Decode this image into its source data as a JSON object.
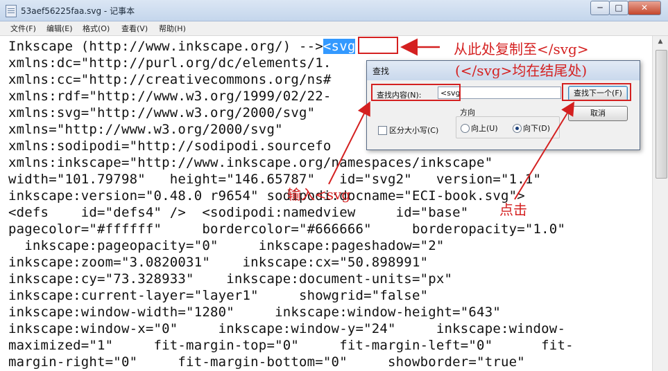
{
  "window": {
    "title": "53aef56225faa.svg - 记事本",
    "minimize": "─",
    "maximize": "□",
    "close": "✕"
  },
  "menu": [
    "文件(F)",
    "编辑(E)",
    "格式(O)",
    "查看(V)",
    "帮助(H)"
  ],
  "editor": {
    "line0_prefix": "Inkscape (http://www.inkscape.org/) -->",
    "line0_selected": "<svg",
    "lines": [
      "xmlns:dc=\"http://purl.org/dc/elements/1.",
      "xmlns:cc=\"http://creativecommons.org/ns#",
      "xmlns:rdf=\"http://www.w3.org/1999/02/22-",
      "xmlns:svg=\"http://www.w3.org/2000/svg\"",
      "xmlns=\"http://www.w3.org/2000/svg\"",
      "xmlns:sodipodi=\"http://sodipodi.sourcefo",
      "xmlns:inkscape=\"http://www.inkscape.org/namespaces/inkscape\"",
      "width=\"101.79798\"   height=\"146.65787\"   id=\"svg2\"   version=\"1.1\"",
      "inkscape:version=\"0.48.0 r9654\" sodipodi:docname=\"ECI-book.svg\">",
      "<defs    id=\"defs4\" />  <sodipodi:namedview     id=\"base\"",
      "pagecolor=\"#ffffff\"     bordercolor=\"#666666\"     borderopacity=\"1.0\"",
      "  inkscape:pageopacity=\"0\"     inkscape:pageshadow=\"2\"",
      "inkscape:zoom=\"3.0820031\"    inkscape:cx=\"50.898991\"",
      "inkscape:cy=\"73.328933\"    inkscape:document-units=\"px\"",
      "inkscape:current-layer=\"layer1\"     showgrid=\"false\"",
      "inkscape:window-width=\"1280\"     inkscape:window-height=\"643\"",
      "inkscape:window-x=\"0\"     inkscape:window-y=\"24\"     inkscape:window-",
      "maximized=\"1\"     fit-margin-top=\"0\"     fit-margin-left=\"0\"      fit-",
      "margin-right=\"0\"     fit-margin-bottom=\"0\"     showborder=\"true\""
    ]
  },
  "find_dialog": {
    "title": "查找",
    "find_label": "查找内容(N):",
    "find_value": "<svg",
    "find_next_button": "查找下一个(F)",
    "cancel_button": "取消",
    "direction_label": "方向",
    "up_label": "向上(U)",
    "down_label": "向下(D)",
    "match_case_label": "区分大小写(C)",
    "direction_selected": "down"
  },
  "annotations": {
    "copy_note": "从此处复制至</svg>",
    "end_note": "(</svg>均在结尾处)",
    "input_note": "输入<svg",
    "click_note": "点击"
  },
  "colors": {
    "annotation": "#d42020",
    "selection": "#3399ff"
  }
}
